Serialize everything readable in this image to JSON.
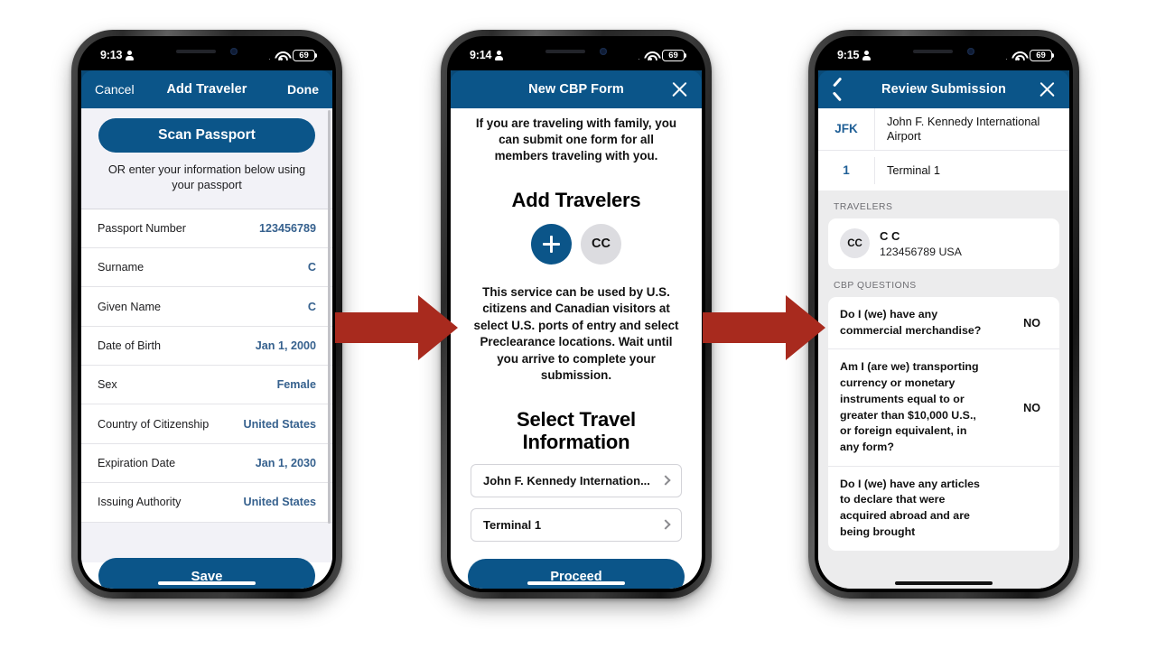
{
  "phones": [
    {
      "status": {
        "time": "9:13",
        "battery": "69"
      },
      "nav": {
        "left": "Cancel",
        "title": "Add Traveler",
        "right": "Done"
      },
      "scan_button": "Scan Passport",
      "subtitle": "OR enter your information below using your passport",
      "fields": [
        {
          "label": "Passport Number",
          "value": "123456789"
        },
        {
          "label": "Surname",
          "value": "C"
        },
        {
          "label": "Given Name",
          "value": "C"
        },
        {
          "label": "Date of Birth",
          "value": "Jan 1, 2000"
        },
        {
          "label": "Sex",
          "value": "Female"
        },
        {
          "label": "Country of Citizenship",
          "value": "United States"
        },
        {
          "label": "Expiration Date",
          "value": "Jan 1, 2030"
        },
        {
          "label": "Issuing Authority",
          "value": "United States"
        }
      ],
      "save_button": "Save"
    },
    {
      "status": {
        "time": "9:14",
        "battery": "69"
      },
      "nav": {
        "title": "New CBP Form",
        "close": "close-icon"
      },
      "intro": "If you are traveling with family, you can submit one form for all members traveling with you.",
      "add_travelers_heading": "Add Travelers",
      "avatars": [
        {
          "type": "add",
          "label": "+"
        },
        {
          "type": "initials",
          "label": "CC"
        }
      ],
      "body": "This service can be used by U.S. citizens and Canadian visitors at select U.S. ports of entry and select Preclearance locations. Wait until you arrive to complete your submission.",
      "select_heading": "Select Travel Information",
      "select_rows": [
        "John F. Kennedy Internation...",
        "Terminal 1"
      ],
      "proceed_button": "Proceed"
    },
    {
      "status": {
        "time": "9:15",
        "battery": "69"
      },
      "nav": {
        "back": "back-icon",
        "title": "Review Submission",
        "close": "close-icon"
      },
      "airport_rows": [
        {
          "code": "JFK",
          "name": "John F. Kennedy International Airport"
        },
        {
          "code": "1",
          "name": "Terminal 1"
        }
      ],
      "travelers_label": "TRAVELERS",
      "traveler": {
        "initials": "CC",
        "name": "C C",
        "details": "123456789 USA"
      },
      "questions_label": "CBP QUESTIONS",
      "questions": [
        {
          "text": "Do I (we) have any commercial merchandise?",
          "answer": "NO"
        },
        {
          "text": "Am I (are we) transporting currency or monetary instruments equal to or greater than $10,000 U.S., or foreign equivalent, in any form?",
          "answer": "NO"
        },
        {
          "text": "Do I (we) have any articles to declare that were acquired abroad and are being brought",
          "answer": ""
        }
      ]
    }
  ],
  "colors": {
    "brand_blue": "#0b5589",
    "value_blue": "#36618e",
    "arrow_red": "#a82a1e",
    "screen_bg": "#ececed"
  }
}
